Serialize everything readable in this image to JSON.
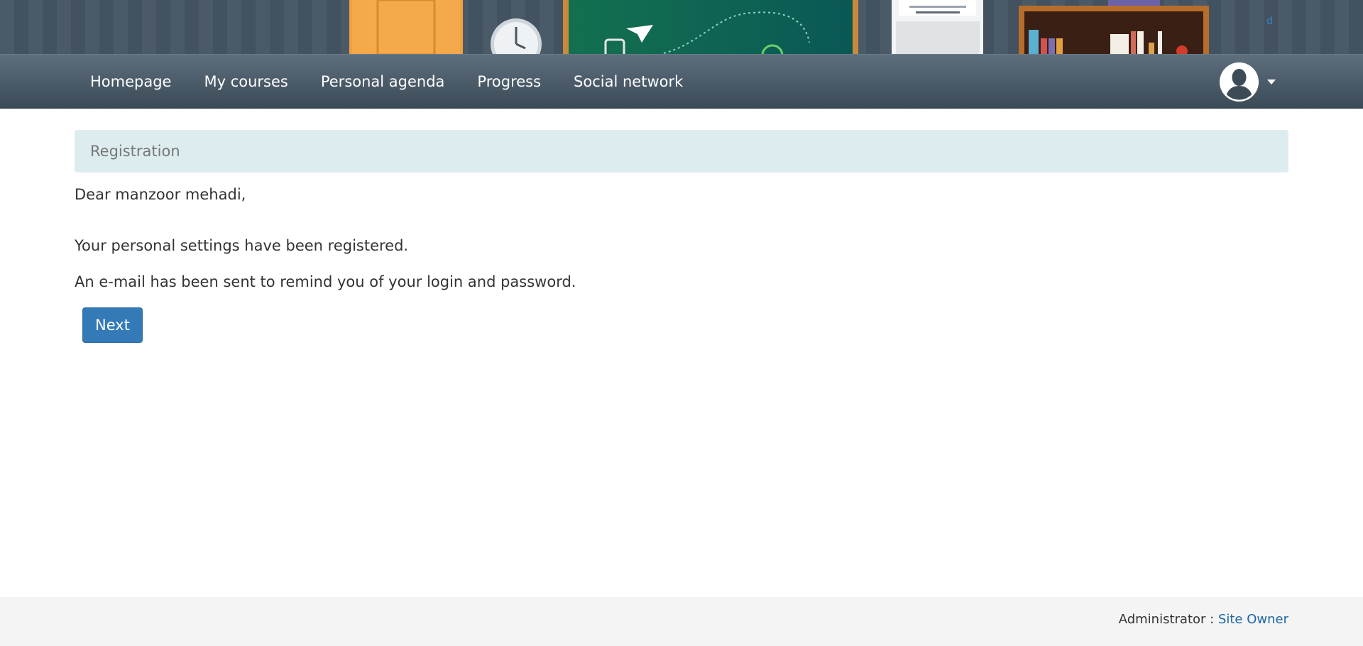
{
  "banner": {
    "corner_link": "d"
  },
  "nav": {
    "items": [
      {
        "label": "Homepage"
      },
      {
        "label": "My courses"
      },
      {
        "label": "Personal agenda"
      },
      {
        "label": "Progress"
      },
      {
        "label": "Social network"
      }
    ],
    "user_icon": "user-avatar-icon",
    "dropdown_icon": "caret-down-icon"
  },
  "breadcrumb": {
    "current": "Registration"
  },
  "message": {
    "greeting": "Dear manzoor mehadi,",
    "line1": "Your personal settings have been registered.",
    "line2": "An e-mail has been sent to remind you of your login and password."
  },
  "actions": {
    "next_label": "Next"
  },
  "footer": {
    "admin_label": "Administrator : ",
    "admin_name": "Site Owner"
  },
  "colors": {
    "navbar": "#3b4a56",
    "breadcrumb_bg": "#ddedef",
    "primary_button": "#337ab7",
    "footer_bg": "#f4f4f4",
    "link": "#1f66a8"
  }
}
